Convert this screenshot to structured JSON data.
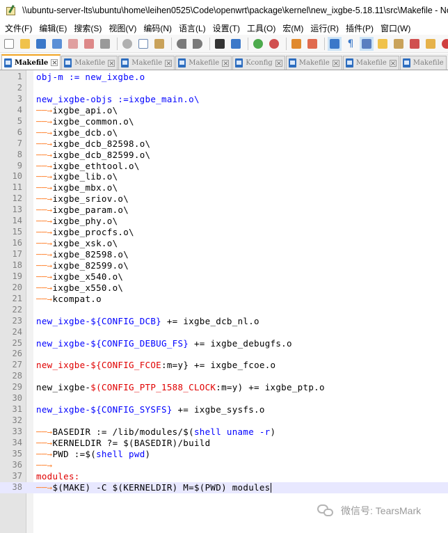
{
  "window": {
    "title": "\\\\ubuntu-server-lts\\ubuntu\\home\\leihen0525\\Code\\openwrt\\package\\kernel\\new_ixgbe-5.18.11\\src\\Makefile - No"
  },
  "menu": [
    "文件(F)",
    "编辑(E)",
    "搜索(S)",
    "视图(V)",
    "编码(N)",
    "语言(L)",
    "设置(T)",
    "工具(O)",
    "宏(M)",
    "运行(R)",
    "插件(P)",
    "窗口(W)"
  ],
  "tabs": [
    {
      "label": "Makefile",
      "active": true
    },
    {
      "label": "Makefile",
      "active": false
    },
    {
      "label": "Makefile",
      "active": false
    },
    {
      "label": "Makefile",
      "active": false
    },
    {
      "label": "Kconfig",
      "active": false
    },
    {
      "label": "Makefile",
      "active": false
    },
    {
      "label": "Makefile",
      "active": false
    },
    {
      "label": "Makefile",
      "active": false
    }
  ],
  "editor": {
    "tab_glyph": "──→",
    "line_numbers": [
      "1",
      "2",
      "3",
      "4",
      "5",
      "6",
      "7",
      "8",
      "9",
      "10",
      "11",
      "12",
      "13",
      "14",
      "15",
      "16",
      "17",
      "18",
      "19",
      "20",
      "21",
      "22",
      "23",
      "24",
      "25",
      "26",
      "27",
      "28",
      "29",
      "30",
      "31",
      "32",
      "33",
      "34",
      "35",
      "36",
      "37",
      "38"
    ],
    "lines": {
      "l1": "obj-m := new_ixgbe.o",
      "l3": "new_ixgbe-objs :=ixgbe_main.o\\",
      "l4": "ixgbe_api.o\\",
      "l5": "ixgbe_common.o\\",
      "l6": "ixgbe_dcb.o\\",
      "l7": "ixgbe_dcb_82598.o\\",
      "l8": "ixgbe_dcb_82599.o\\",
      "l9": "ixgbe_ethtool.o\\",
      "l10": "ixgbe_lib.o\\",
      "l11": "ixgbe_mbx.o\\",
      "l12": "ixgbe_sriov.o\\",
      "l13": "ixgbe_param.o\\",
      "l14": "ixgbe_phy.o\\",
      "l15": "ixgbe_procfs.o\\",
      "l16": "ixgbe_xsk.o\\",
      "l17": "ixgbe_82598.o\\",
      "l18": "ixgbe_82599.o\\",
      "l19": "ixgbe_x540.o\\",
      "l20": "ixgbe_x550.o\\",
      "l21": "kcompat.o",
      "l23a": "new_ixgbe-$",
      "l23b": "{CONFIG_DCB}",
      "l23c": " += ixgbe_dcb_nl.o",
      "l25a": "new_ixgbe-$",
      "l25b": "{CONFIG_DEBUG_FS}",
      "l25c": " += ixgbe_debugfs.o",
      "l27a": "new_ixgbe-$",
      "l27b": "{CONFIG_FCOE",
      "l27c": ":m=y}",
      "l27d": " += ixgbe_fcoe.o",
      "l29a": "new_ixgbe-",
      "l29b": "$(CONFIG_PTP_1588_CLOCK",
      "l29c": ":m=y)",
      "l29d": " += ixgbe_ptp.o",
      "l31a": "new_ixgbe-$",
      "l31b": "{CONFIG_SYSFS}",
      "l31c": " += ixgbe_sysfs.o",
      "l33a": "BASEDIR := /lib/modules/$(",
      "l33b": "shell uname -r",
      "l33c": ")",
      "l34": "KERNELDIR ?= $(BASEDIR)/build",
      "l35a": "PWD :=$(",
      "l35b": "shell pwd",
      "l35c": ")",
      "l37": "modules:",
      "l38": "$(MAKE) -C $(KERNELDIR) M=$(PWD) modules"
    }
  },
  "watermark": {
    "text": "微信号: TearsMark"
  },
  "colors": {
    "keyword": "#0000ff",
    "config_red": "#e00000",
    "tab_arrow": "#ff8b3d",
    "active_tab_accent": "#f5a623"
  }
}
